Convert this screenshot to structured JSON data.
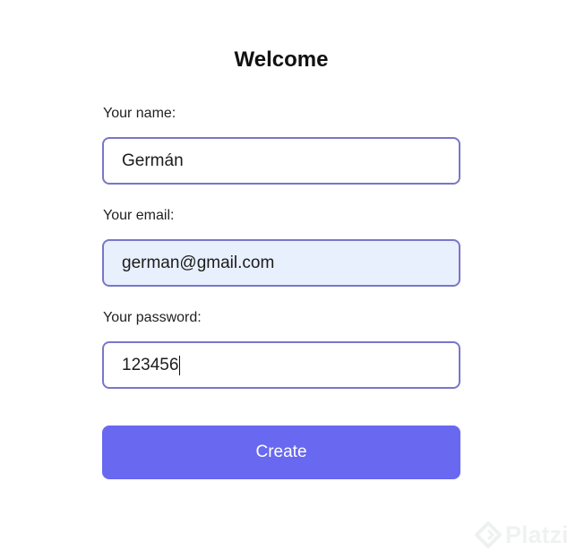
{
  "form": {
    "title": "Welcome",
    "name_label": "Your name:",
    "name_value": "Germán",
    "email_label": "Your email:",
    "email_value": "german@gmail.com",
    "password_label": "Your password:",
    "password_value": "123456",
    "submit_label": "Create"
  },
  "watermark": {
    "text": "Platzi",
    "icon": "platzi-logo-icon"
  },
  "colors": {
    "accent": "#6868f0",
    "input_border": "#7a76c8",
    "autofill_background": "#e8f0fe"
  }
}
